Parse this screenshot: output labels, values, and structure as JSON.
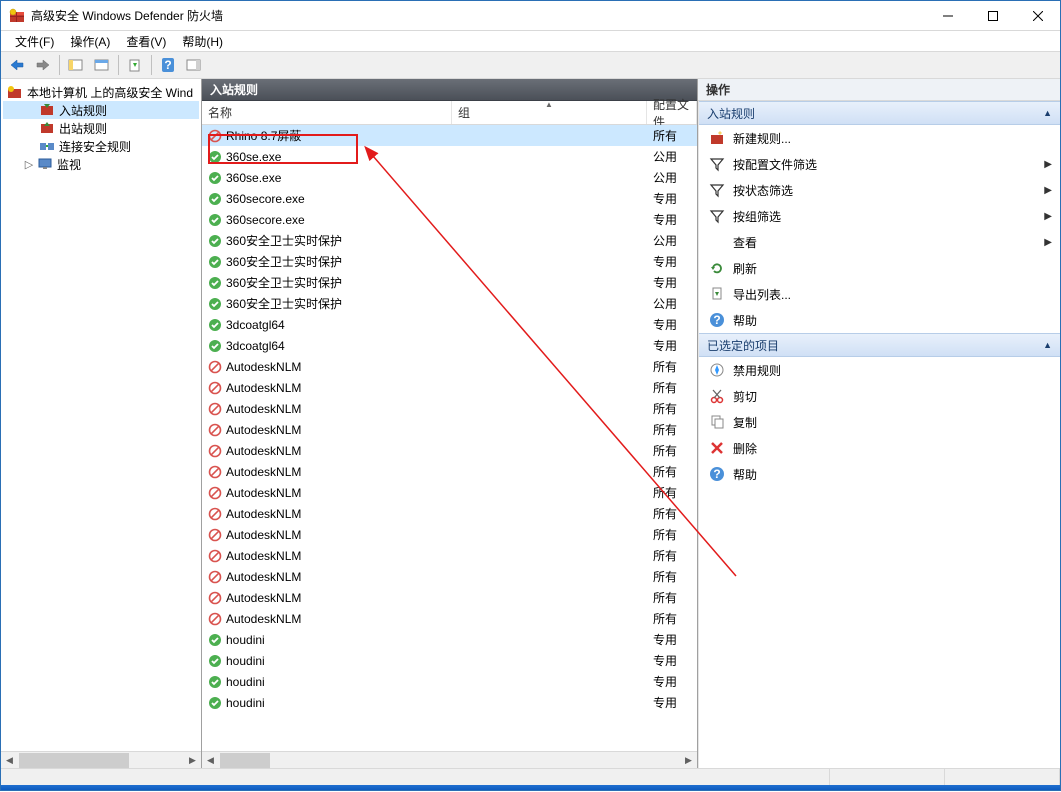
{
  "window": {
    "title": "高级安全 Windows Defender 防火墙"
  },
  "menubar": [
    "文件(F)",
    "操作(A)",
    "查看(V)",
    "帮助(H)"
  ],
  "tree": {
    "root": "本地计算机 上的高级安全 Wind",
    "items": [
      {
        "label": "入站规则",
        "icon": "inbound",
        "selected": true
      },
      {
        "label": "出站规则",
        "icon": "outbound"
      },
      {
        "label": "连接安全规则",
        "icon": "connsec"
      },
      {
        "label": "监视",
        "icon": "monitor",
        "expandable": true
      }
    ]
  },
  "list": {
    "title": "入站规则",
    "columns": {
      "name": "名称",
      "group": "组",
      "profile": "配置文件"
    },
    "rows": [
      {
        "icon": "block",
        "name": "Rhino 8.7屏蔽",
        "profile": "所有",
        "selected": true
      },
      {
        "icon": "allow",
        "name": "360se.exe",
        "profile": "公用"
      },
      {
        "icon": "allow",
        "name": "360se.exe",
        "profile": "公用"
      },
      {
        "icon": "allow",
        "name": "360secore.exe",
        "profile": "专用"
      },
      {
        "icon": "allow",
        "name": "360secore.exe",
        "profile": "专用"
      },
      {
        "icon": "allow",
        "name": "360安全卫士实时保护",
        "profile": "公用"
      },
      {
        "icon": "allow",
        "name": "360安全卫士实时保护",
        "profile": "专用"
      },
      {
        "icon": "allow",
        "name": "360安全卫士实时保护",
        "profile": "专用"
      },
      {
        "icon": "allow",
        "name": "360安全卫士实时保护",
        "profile": "公用"
      },
      {
        "icon": "allow",
        "name": "3dcoatgl64",
        "profile": "专用"
      },
      {
        "icon": "allow",
        "name": "3dcoatgl64",
        "profile": "专用"
      },
      {
        "icon": "block",
        "name": "AutodeskNLM",
        "profile": "所有"
      },
      {
        "icon": "block",
        "name": "AutodeskNLM",
        "profile": "所有"
      },
      {
        "icon": "block",
        "name": "AutodeskNLM",
        "profile": "所有"
      },
      {
        "icon": "block",
        "name": "AutodeskNLM",
        "profile": "所有"
      },
      {
        "icon": "block",
        "name": "AutodeskNLM",
        "profile": "所有"
      },
      {
        "icon": "block",
        "name": "AutodeskNLM",
        "profile": "所有"
      },
      {
        "icon": "block",
        "name": "AutodeskNLM",
        "profile": "所有"
      },
      {
        "icon": "block",
        "name": "AutodeskNLM",
        "profile": "所有"
      },
      {
        "icon": "block",
        "name": "AutodeskNLM",
        "profile": "所有"
      },
      {
        "icon": "block",
        "name": "AutodeskNLM",
        "profile": "所有"
      },
      {
        "icon": "block",
        "name": "AutodeskNLM",
        "profile": "所有"
      },
      {
        "icon": "block",
        "name": "AutodeskNLM",
        "profile": "所有"
      },
      {
        "icon": "block",
        "name": "AutodeskNLM",
        "profile": "所有"
      },
      {
        "icon": "allow",
        "name": "houdini",
        "profile": "专用"
      },
      {
        "icon": "allow",
        "name": "houdini",
        "profile": "专用"
      },
      {
        "icon": "allow",
        "name": "houdini",
        "profile": "专用"
      },
      {
        "icon": "allow",
        "name": "houdini",
        "profile": "专用"
      }
    ]
  },
  "actions": {
    "header": "操作",
    "group1": {
      "title": "入站规则",
      "items": [
        {
          "icon": "new",
          "label": "新建规则..."
        },
        {
          "icon": "filter",
          "label": "按配置文件筛选",
          "sub": true
        },
        {
          "icon": "filter",
          "label": "按状态筛选",
          "sub": true
        },
        {
          "icon": "filter",
          "label": "按组筛选",
          "sub": true
        },
        {
          "icon": "none",
          "label": "查看",
          "sub": true
        },
        {
          "icon": "refresh",
          "label": "刷新"
        },
        {
          "icon": "export",
          "label": "导出列表..."
        },
        {
          "icon": "help",
          "label": "帮助"
        }
      ]
    },
    "group2": {
      "title": "已选定的项目",
      "items": [
        {
          "icon": "disable",
          "label": "禁用规则"
        },
        {
          "icon": "cut",
          "label": "剪切"
        },
        {
          "icon": "copy",
          "label": "复制"
        },
        {
          "icon": "delete",
          "label": "删除"
        },
        {
          "icon": "help",
          "label": "帮助"
        }
      ]
    }
  }
}
